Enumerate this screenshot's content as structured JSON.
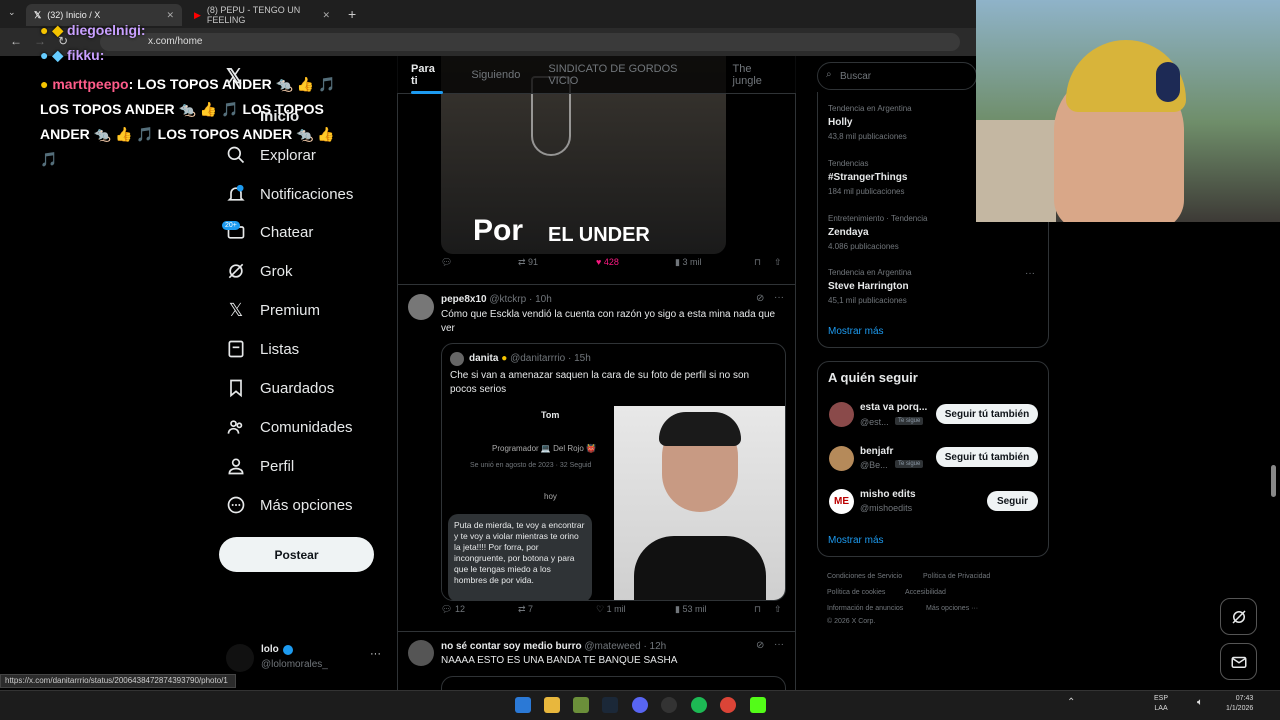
{
  "browser": {
    "tabs": [
      {
        "label": "(32) Inicio / X"
      },
      {
        "label": "(8) PEPU - TENGO UN FEELING"
      }
    ],
    "url": "x.com/home",
    "status_url": "https://x.com/danitarrrio/status/2006438472874393790/photo/1"
  },
  "chat_overlay": [
    {
      "user": "diegoelnigi:",
      "text": ""
    },
    {
      "user": "fikku:",
      "text": ""
    },
    {
      "user": "marttpeepo",
      "text": ": LOS TOPOS ANDER",
      "line2": "LOS TOPOS ANDER",
      "line2b": "LOS TOPOS",
      "line3": "ANDER",
      "line3b": "LOS TOPOS ANDER"
    }
  ],
  "nav": {
    "items": [
      {
        "label": "Inicio"
      },
      {
        "label": "Explorar"
      },
      {
        "label": "Notificaciones"
      },
      {
        "label": "Chatear",
        "badge": "20+"
      },
      {
        "label": "Grok"
      },
      {
        "label": "Premium"
      },
      {
        "label": "Listas"
      },
      {
        "label": "Guardados"
      },
      {
        "label": "Comunidades"
      },
      {
        "label": "Perfil"
      },
      {
        "label": "Más opciones"
      }
    ],
    "post_label": "Postear",
    "user": {
      "name": "lolo",
      "handle": "@lolomorales_"
    }
  },
  "feed": {
    "tabs": [
      "Para ti",
      "Siguiendo",
      "SINDICATO DE GORDOS VICIO",
      "The jungle"
    ],
    "tweet0": {
      "image_text_1": "Por",
      "image_text_2": "EL UNDER",
      "retweets": "91",
      "likes": "428",
      "views": "3 mil"
    },
    "tweet1": {
      "name": "pepe8x10",
      "handle": "@ktckrp",
      "time": "· 10h",
      "text": "Cómo que Esckla vendió la cuenta con razón yo sigo a esta mina nada que ver",
      "quote": {
        "name": "danita",
        "handle": "@danitarrrio",
        "time": "· 15h",
        "text": "Che si van a amenazar saquen la cara de su foto de perfil si no son pocos serios",
        "dm_name": "Tom",
        "dm_bio": "Programador 💻 Del Rojo 👹",
        "dm_joined": "Se unió en agosto de 2023 · 32 Seguid",
        "dm_day": "hoy",
        "dm_msg": "Puta de mierda, te voy a encontrar y te voy a violar mientras te orino la jeta!!!! Por forra, por incongruente, por botona y para que le tengas miedo a los hombres de por vida."
      },
      "replies": "12",
      "retweets": "7",
      "likes": "1 mil",
      "views": "53 mil"
    },
    "tweet2": {
      "name": "no sé contar soy medio burro",
      "handle": "@mateweed",
      "time": "· 12h",
      "text": "NAAAA ESTO ES UNA BANDA TE BANQUE SASHA"
    }
  },
  "sidebar": {
    "search_placeholder": "Buscar",
    "trends": [
      {
        "context": "Tendencia en Argentina",
        "title": "Holly",
        "count": "43,8 mil publicaciones"
      },
      {
        "context": "Tendencias",
        "title": "#StrangerThings",
        "count": "184 mil publicaciones"
      },
      {
        "context": "Entretenimiento · Tendencia",
        "title": "Zendaya",
        "count": "4.086 publicaciones"
      },
      {
        "context": "Tendencia en Argentina",
        "title": "Steve Harrington",
        "count": "45,1 mil publicaciones"
      }
    ],
    "show_more": "Mostrar más",
    "who_to_follow": {
      "title": "A quién seguir",
      "users": [
        {
          "name": "esta va porq...",
          "handle": "@est...",
          "follows_you": "Te sigue",
          "btn": "Seguir tú también"
        },
        {
          "name": "benjafr",
          "handle": "@Be...",
          "follows_you": "Te sigue",
          "btn": "Seguir tú también"
        },
        {
          "name": "misho edits",
          "handle": "@mishoedits",
          "btn": "Seguir"
        }
      ],
      "show_more": "Mostrar más"
    },
    "footer": {
      "l1a": "Condiciones de Servicio",
      "l1b": "Política de Privacidad",
      "l2a": "Política de cookies",
      "l2b": "Accesibilidad",
      "l3a": "Información de anuncios",
      "l3b": "Más opciones ···",
      "l4": "© 2026 X Corp."
    }
  },
  "taskbar": {
    "lang1": "ESP",
    "lang2": "LAA",
    "time": "07:43",
    "date": "1/1/2026"
  },
  "colors": {
    "accent": "#1d9bf0",
    "like": "#f91880",
    "bg": "#000000"
  }
}
